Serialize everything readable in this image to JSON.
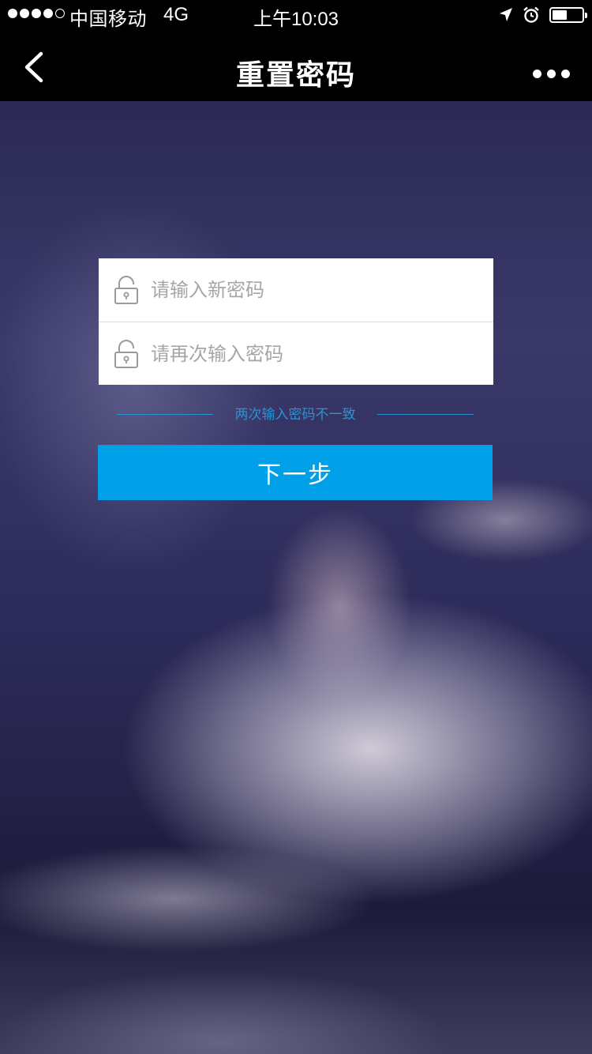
{
  "status_bar": {
    "carrier": "中国移动",
    "network": "4G",
    "time": "上午10:03",
    "signal_strength": 4,
    "signal_total": 5,
    "battery_level": 0.5
  },
  "nav": {
    "title": "重置密码"
  },
  "form": {
    "new_password_placeholder": "请输入新密码",
    "confirm_password_placeholder": "请再次输入密码",
    "error_message": "两次输入密码不一致",
    "next_label": "下一步"
  },
  "colors": {
    "accent": "#00a0e9",
    "error": "#2a93d5"
  },
  "icons": {
    "back": "chevron-left-icon",
    "more": "more-dots-icon",
    "field": "lock-icon"
  }
}
